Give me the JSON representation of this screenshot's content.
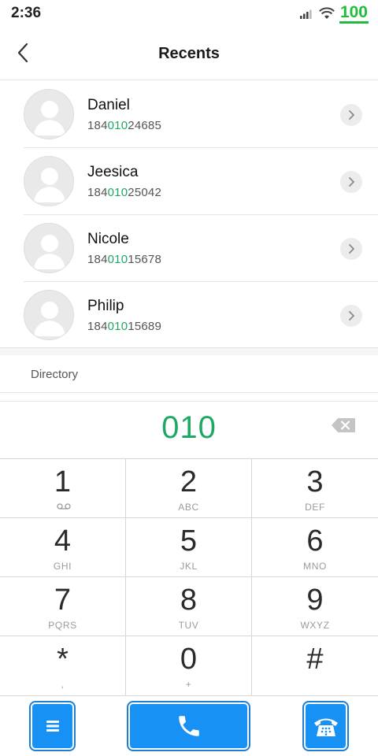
{
  "status_bar": {
    "time": "2:36",
    "battery": "100"
  },
  "header": {
    "title": "Recents"
  },
  "contacts": [
    {
      "name": "Daniel",
      "number_prefix": "184",
      "number_match": "010",
      "number_suffix": "24685"
    },
    {
      "name": "Jeesica",
      "number_prefix": "184",
      "number_match": "010",
      "number_suffix": "25042"
    },
    {
      "name": "Nicole",
      "number_prefix": "184",
      "number_match": "010",
      "number_suffix": "15678"
    },
    {
      "name": "Philip",
      "number_prefix": "184",
      "number_match": "010",
      "number_suffix": "15689"
    }
  ],
  "directory": {
    "label": "Directory"
  },
  "dialer": {
    "dialed_number": "010"
  },
  "keypad": [
    {
      "digit": "1",
      "letters": ""
    },
    {
      "digit": "2",
      "letters": "ABC"
    },
    {
      "digit": "3",
      "letters": "DEF"
    },
    {
      "digit": "4",
      "letters": "GHI"
    },
    {
      "digit": "5",
      "letters": "JKL"
    },
    {
      "digit": "6",
      "letters": "MNO"
    },
    {
      "digit": "7",
      "letters": "PQRS"
    },
    {
      "digit": "8",
      "letters": "TUV"
    },
    {
      "digit": "9",
      "letters": "WXYZ"
    },
    {
      "digit": "*",
      "letters": ","
    },
    {
      "digit": "0",
      "letters": "+"
    },
    {
      "digit": "#",
      "letters": ""
    }
  ],
  "icons": {
    "back": "chevron-left-icon",
    "contact_action": "chevron-right-icon",
    "backspace": "backspace-icon",
    "voicemail": "voicemail-icon",
    "menu": "menu-icon",
    "call": "phone-icon",
    "dialpad": "dialpad-phone-icon"
  },
  "colors": {
    "accent_green": "#1fa865",
    "battery_green": "#1fbd3a",
    "button_blue": "#1891f5"
  }
}
